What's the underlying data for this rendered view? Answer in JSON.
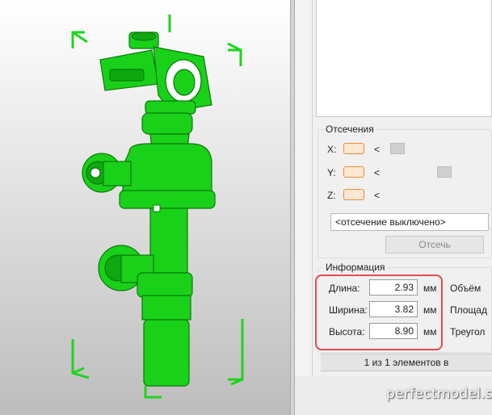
{
  "colors": {
    "model": "#19d119",
    "model_dark": "#0c8f0c",
    "bbox": "#1ed41e",
    "highlight": "#e44d4d",
    "accent": "#e88d3a"
  },
  "viewport": {
    "label": "3d-model-view"
  },
  "clipping": {
    "title": "Отсечения",
    "axes": [
      {
        "label": "X:",
        "arrow": "<",
        "position": 0.08
      },
      {
        "label": "Y:",
        "arrow": "<",
        "position": 0.62
      },
      {
        "label": "Z:",
        "arrow": "<",
        "position": null
      }
    ],
    "select_value": "<отсечение выключено>",
    "button_label": "Отсечь"
  },
  "info": {
    "title": "Информация",
    "rows": [
      {
        "label": "Длина:",
        "value": "2.93",
        "unit": "мм",
        "extra": "Объём"
      },
      {
        "label": "Ширина:",
        "value": "3.82",
        "unit": "мм",
        "extra": "Площад"
      },
      {
        "label": "Высота:",
        "value": "8.90",
        "unit": "мм",
        "extra": "Треугол"
      }
    ]
  },
  "status": "1 из 1 элементов в",
  "watermark": "perfectmodel.su"
}
